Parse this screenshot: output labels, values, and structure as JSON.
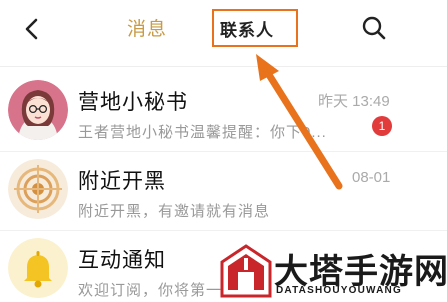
{
  "header": {
    "tabs": [
      {
        "label": "消息",
        "active": false
      },
      {
        "label": "联系人",
        "highlighted": true
      }
    ],
    "icons": {
      "back": "chevron-left-icon",
      "search": "search-icon"
    }
  },
  "conversations": [
    {
      "title": "营地小秘书",
      "preview": "王者营地小秘书温馨提醒：你下0...",
      "time": "昨天 13:49",
      "unread": "1",
      "avatar": "girl-avatar"
    },
    {
      "title": "附近开黑",
      "preview": "附近开黑，有邀请就有消息",
      "time": "08-01",
      "avatar": "radar-avatar"
    },
    {
      "title": "互动通知",
      "preview": "欢迎订阅，你将第一",
      "avatar": "bell-avatar"
    }
  ],
  "annotation": {
    "color": "#e8731c"
  },
  "watermark": {
    "cn": "大塔手游网",
    "en": "DATASHOUYOUWANG"
  },
  "colors": {
    "accent": "#c89b46",
    "badge": "#e23b3b",
    "arrow": "#e8731c",
    "watermark_red": "#c9262b"
  }
}
